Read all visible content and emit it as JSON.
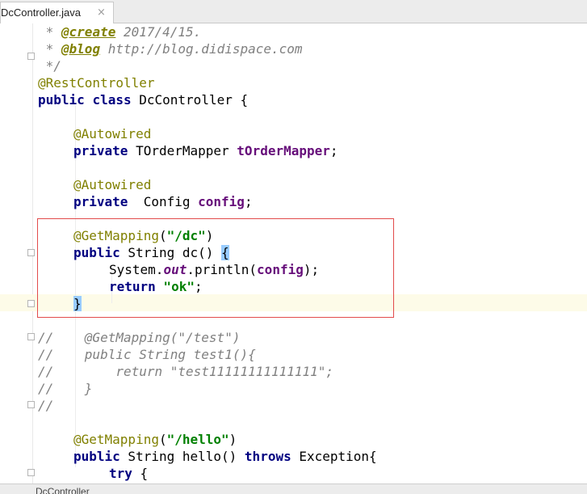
{
  "tab": {
    "title": "DcController.java",
    "close_glyph": "×"
  },
  "code": {
    "l1": {
      "star": " * ",
      "tag": "@create",
      "rest": " 2017/4/15."
    },
    "l2": {
      "star": " * ",
      "tag": "@blog",
      "rest": " http://blog.didispace.com"
    },
    "l3": " */",
    "l4": "@RestController",
    "l5": {
      "kw1": "public",
      "kw2": "class",
      "name": "DcController",
      "rest": " {"
    },
    "l7": "@Autowired",
    "l8": {
      "kw": "private",
      "type": " TOrderMapper ",
      "field": "tOrderMapper",
      "rest": ";"
    },
    "l10": "@Autowired",
    "l11": {
      "kw": "private",
      "type": "  Config ",
      "field": "config",
      "rest": ";"
    },
    "l13": {
      "ann": "@GetMapping",
      "open": "(",
      "str": "\"/dc\"",
      "close": ")"
    },
    "l14": {
      "kw": "public",
      "type": " String dc() ",
      "brace": "{"
    },
    "l15": {
      "a": "System.",
      "static": "out",
      "b": ".println(",
      "field": "config",
      "c": ");"
    },
    "l16": {
      "kw": "return",
      "str": " \"ok\"",
      "rest": ";"
    },
    "l17": "}",
    "l19": "//    @GetMapping(\"/test\")",
    "l20": "//    public String test1(){",
    "l21": "//        return \"test11111111111111\";",
    "l22": "//    }",
    "l23": "//",
    "l25": {
      "ann": "@GetMapping",
      "open": "(",
      "str": "\"/hello\"",
      "close": ")"
    },
    "l26": {
      "kw1": "public",
      "type": " String hello() ",
      "kw2": "throws",
      "rest": " Exception{"
    },
    "l27": {
      "kw": "try",
      "rest": " {"
    }
  },
  "status": {
    "text": "DcController"
  }
}
